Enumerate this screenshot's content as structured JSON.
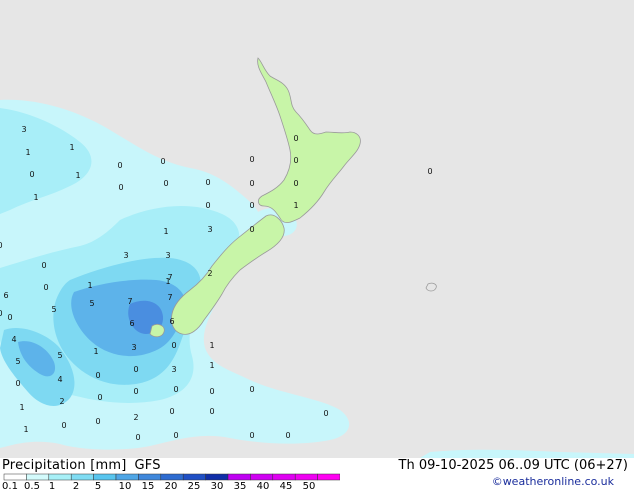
{
  "header": {
    "title": "Precipitation [mm]",
    "model": "GFS",
    "valid_time": "Th 09-10-2025 06..09 UTC (06+27)",
    "credit": "©weatheronline.co.uk"
  },
  "legend": {
    "labels": [
      "0.1",
      "0.5",
      "1",
      "2",
      "5",
      "10",
      "15",
      "20",
      "25",
      "30",
      "35",
      "40",
      "45",
      "50"
    ],
    "colors": [
      "#ffffff",
      "#d4fbfc",
      "#a8f0f7",
      "#7fdcf3",
      "#58c5ee",
      "#4fa6e6",
      "#3f87db",
      "#2d6bd0",
      "#1f4fc5",
      "#102ea8",
      "#bf00f2",
      "#cf00f2",
      "#df00f2",
      "#ef00f2",
      "#ff00f2"
    ]
  },
  "map": {
    "colors": {
      "sea": "#e6e6e6",
      "land": "#c8f5a8",
      "coast": "#9a9a9a",
      "precip_light": "#c8f6fb",
      "precip_2": "#a8eef8",
      "precip_5": "#7ed9f2",
      "precip_10": "#5db3ea",
      "precip_15": "#4a8ee0"
    },
    "values": [
      "3",
      "1",
      "1",
      "0",
      "0",
      "0",
      "1",
      "0",
      "0",
      "0",
      "0",
      "0",
      "0",
      "0",
      "0",
      "1",
      "0",
      "0",
      "1",
      "3",
      "0",
      "0",
      "1",
      "3",
      "3",
      "1",
      "7",
      "2",
      "0",
      "6",
      "7",
      "7",
      "0",
      "5",
      "5",
      "6",
      "6",
      "5",
      "0",
      "0",
      "4",
      "5",
      "1",
      "3",
      "0",
      "1",
      "1",
      "3",
      "0",
      "0",
      "4",
      "2",
      "0",
      "1",
      "0",
      "2",
      "1",
      "0",
      "0",
      "0",
      "1",
      "0",
      "0",
      "0",
      "0",
      "0",
      "0",
      "0",
      "0",
      "0",
      "0",
      "0"
    ]
  }
}
